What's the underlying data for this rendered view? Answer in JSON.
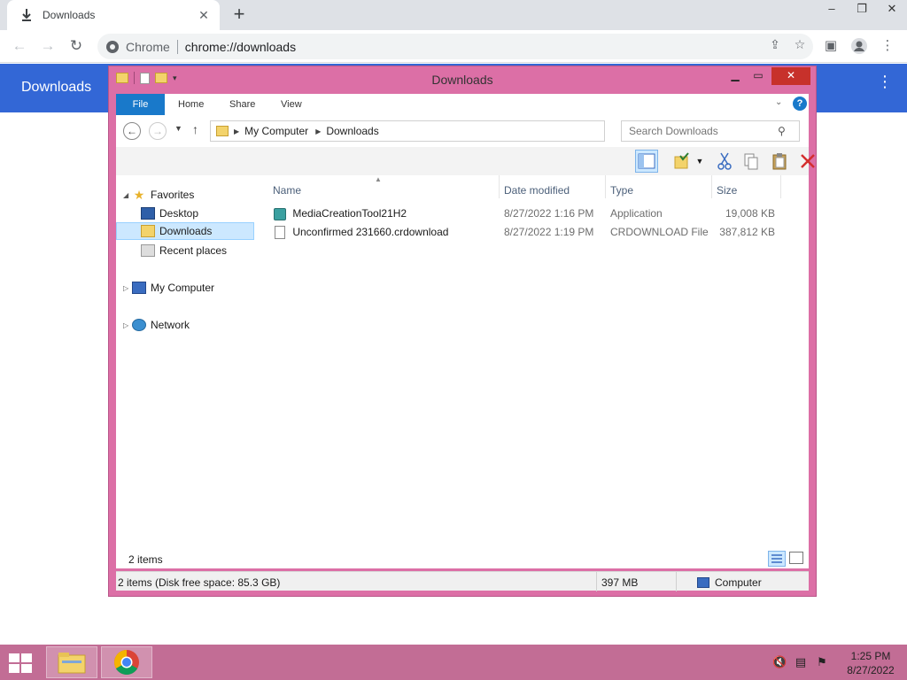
{
  "browser": {
    "tab_title": "Downloads",
    "tab_close": "✕",
    "new_tab": "+",
    "omnibox_site_label": "Chrome",
    "omnibox_url": "chrome://downloads",
    "page_title": "Downloads",
    "page_menu": "⋮",
    "back": "←",
    "forward": "→",
    "reload": "↻"
  },
  "explorer": {
    "window_title": "Downloads",
    "ribbon": {
      "file": "File",
      "tabs": [
        "Home",
        "Share",
        "View"
      ],
      "help": "?"
    },
    "address": {
      "crumbs": [
        "My Computer",
        "Downloads"
      ],
      "search_placeholder": "Search Downloads"
    },
    "nav": {
      "favorites": "Favorites",
      "desktop": "Desktop",
      "downloads": "Downloads",
      "recent_places": "Recent places",
      "my_computer": "My Computer",
      "network": "Network"
    },
    "columns": {
      "name": "Name",
      "date_modified": "Date modified",
      "type": "Type",
      "size": "Size"
    },
    "files": [
      {
        "name": "MediaCreationTool21H2",
        "date": "8/27/2022 1:16 PM",
        "type": "Application",
        "size": "19,008 KB",
        "icon": "application-icon"
      },
      {
        "name": "Unconfirmed 231660.crdownload",
        "date": "8/27/2022 1:19 PM",
        "type": "CRDOWNLOAD File",
        "size": "387,812 KB",
        "icon": "document-icon"
      }
    ],
    "status_count": "2 items",
    "statusbar": {
      "disk": "2 items (Disk free space: 85.3 GB)",
      "size": "397 MB",
      "location": "Computer"
    }
  },
  "taskbar": {
    "time": "1:25 PM",
    "date": "8/27/2022"
  },
  "colors": {
    "chrome_header": "#3367d6",
    "window_frame": "#dc6fa6",
    "taskbar": "#c26d95",
    "accent": "#1979ca"
  }
}
